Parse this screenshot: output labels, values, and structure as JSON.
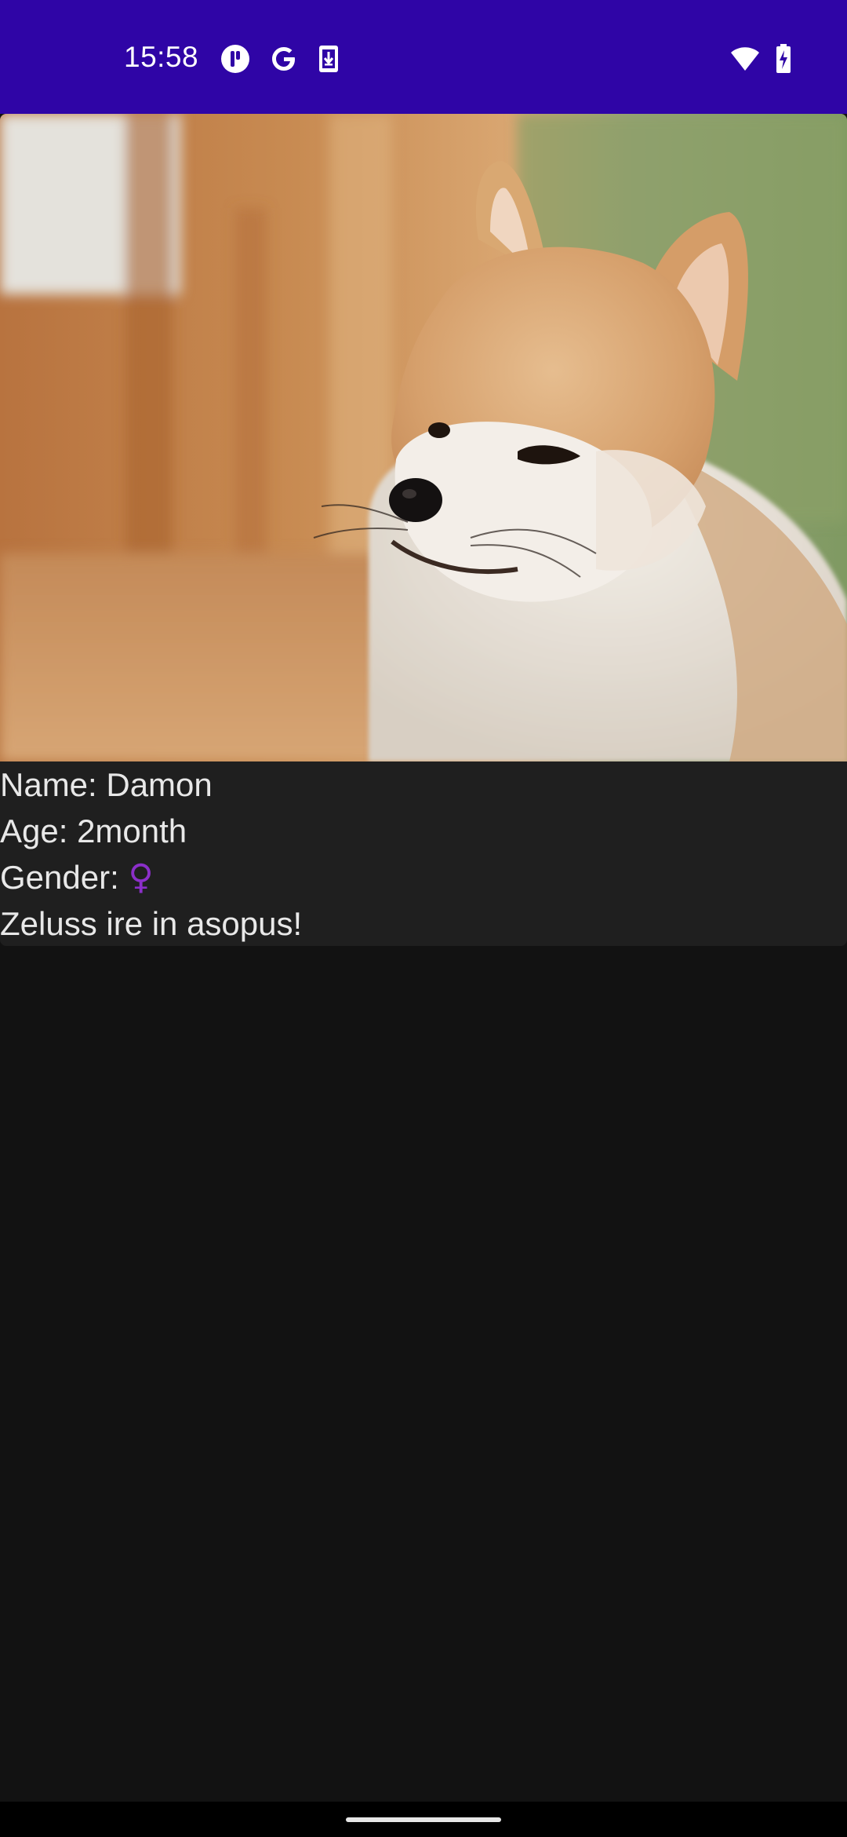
{
  "status_bar": {
    "time": "15:58",
    "background_color": "#2f05a6",
    "left_icons": [
      "notification-app-icon",
      "google-icon",
      "download-icon"
    ],
    "right_icons": [
      "wifi-icon",
      "battery-charging-icon"
    ]
  },
  "pet": {
    "photo_icon": "shiba-puppy-photo",
    "name_line": "Name: Damon",
    "age_line": "Age: 2month",
    "gender_label": "Gender: ",
    "gender_symbol": "♀",
    "gender_color": "#8b2fc9",
    "description": "Zeluss ire in asopus!"
  },
  "nav_bar": {
    "indicator": "home-indicator"
  }
}
